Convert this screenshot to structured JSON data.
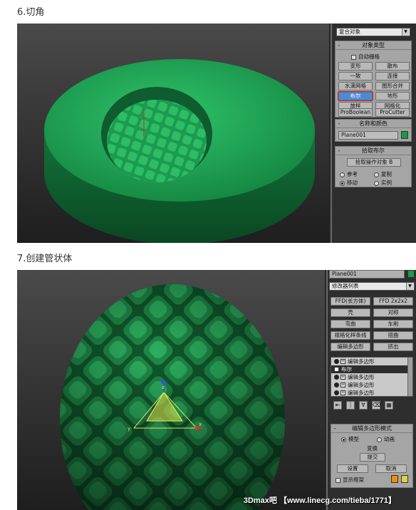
{
  "step6": {
    "title": "6.切角",
    "category_dropdown": "复合对象",
    "object_type": {
      "header": "对象类型",
      "autogrid": "自动栅格",
      "buttons": [
        "变形",
        "散布",
        "一致",
        "连接",
        "水滴网格",
        "图形合并",
        "布尔",
        "地形",
        "放样",
        "网格化",
        "ProBoolean",
        "ProCutter"
      ],
      "active": "布尔"
    },
    "name_color": {
      "header": "名称和颜色",
      "name": "Plane001",
      "color": "#1a9a4a"
    },
    "pick_boolean": {
      "header": "拾取布尔",
      "pick_button": "拾取操作对象 B",
      "options": [
        "参考",
        "复制",
        "移动",
        "实例"
      ],
      "selected": "移动"
    }
  },
  "step7": {
    "title": "7.创建管状体",
    "object_name": "Plane001",
    "object_color": "#1a9a4a",
    "modifier_list": "修改器列表",
    "modifier_buttons": [
      "FFD(长方体)",
      "FFD 2x2x2",
      "壳",
      "对称",
      "弯曲",
      "车削",
      "规格化样条线",
      "扭曲",
      "编辑多边形",
      "挤出"
    ],
    "stack": [
      {
        "label": "编辑多边形",
        "selected": false
      },
      {
        "label": "布尔",
        "selected": true
      },
      {
        "label": "编辑多边形",
        "selected": false
      },
      {
        "label": "编辑多边形",
        "selected": false
      },
      {
        "label": "编辑多边形",
        "selected": false
      }
    ],
    "edit_poly_mode": {
      "header": "编辑多边形模式",
      "options": [
        "模型",
        "动画"
      ],
      "selected": "模型",
      "transform_label": "变换",
      "commit": "提交",
      "settings": "设置",
      "cancel": "取消",
      "show_cage": "显示框架",
      "cage_colors": [
        "#f08c00",
        "#d6d640"
      ]
    },
    "watermark": "3Dmax吧  【www.linecg.com/tieba/1771】"
  }
}
